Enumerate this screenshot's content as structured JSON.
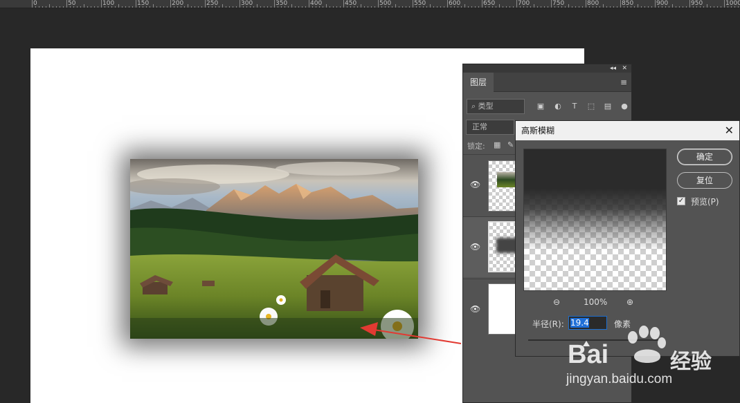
{
  "ruler": {
    "labels": [
      "0",
      "50",
      "100",
      "150",
      "200",
      "250",
      "300",
      "350",
      "400",
      "450",
      "500",
      "550",
      "600",
      "650",
      "700",
      "750",
      "800",
      "850",
      "900",
      "950",
      "1000"
    ]
  },
  "layers_panel": {
    "tab_label": "图层",
    "filter_label": "类型",
    "blend_mode": "正常",
    "lock_label": "锁定:"
  },
  "dialog": {
    "title": "高斯模糊",
    "ok_label": "确定",
    "reset_label": "复位",
    "preview_label": "预览(P)",
    "preview_checked": true,
    "zoom_level": "100%",
    "radius_label": "半径(R):",
    "radius_value": "19.4",
    "radius_unit": "像素"
  },
  "watermark": {
    "brand": "Bai",
    "brand_suffix": "经验",
    "url": "jingyan.baidu.com"
  }
}
